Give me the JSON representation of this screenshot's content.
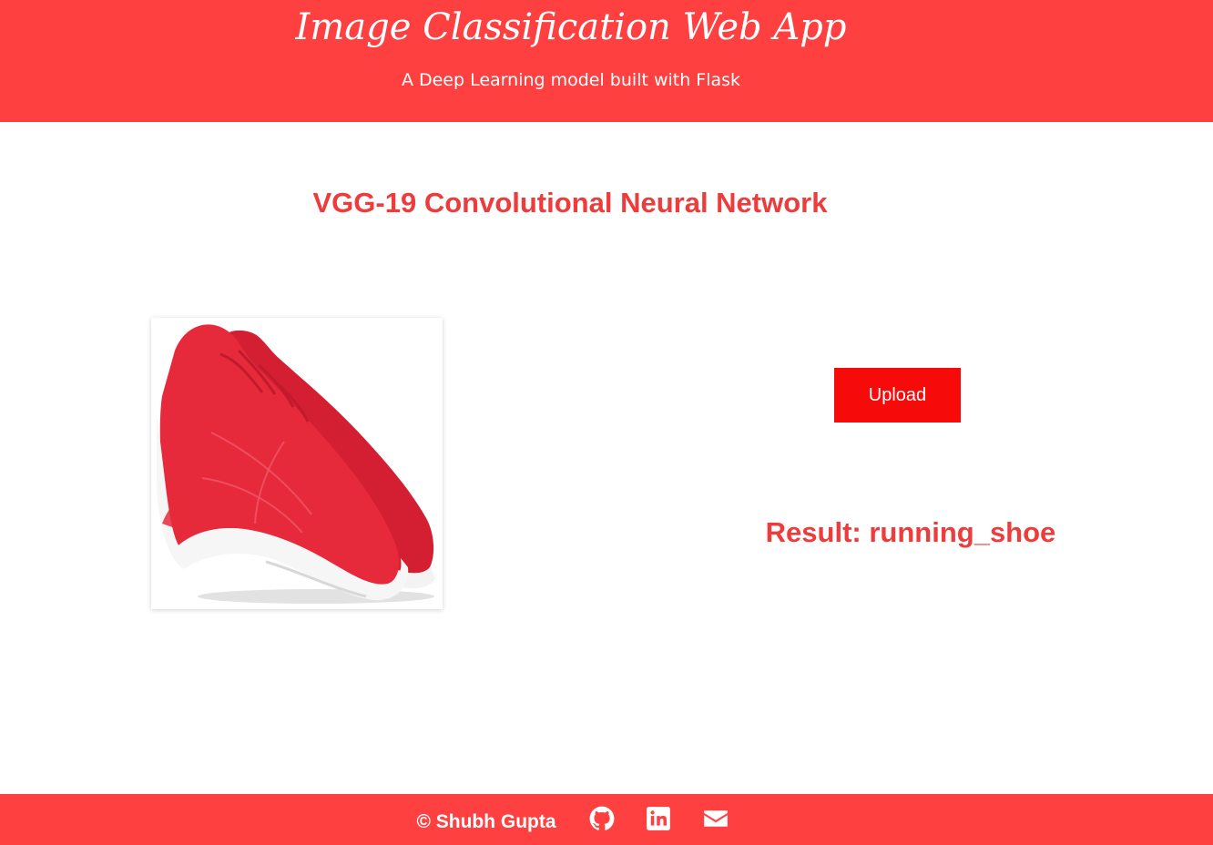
{
  "header": {
    "title": "Image Classification Web App",
    "subtitle": "A Deep Learning model built with Flask"
  },
  "main": {
    "heading": "VGG-19 Convolutional Neural Network",
    "upload_label": "Upload",
    "result_text": "Result: running_shoe",
    "image": {
      "icon": "red-running-shoe-image"
    }
  },
  "footer": {
    "copyright": "© Shubh Gupta",
    "icons": [
      "github-icon",
      "linkedin-icon",
      "envelope-icon"
    ]
  },
  "colors": {
    "brand": "#ff4040",
    "button": "#f70a0a",
    "accent_text": "#ee3c3c"
  }
}
